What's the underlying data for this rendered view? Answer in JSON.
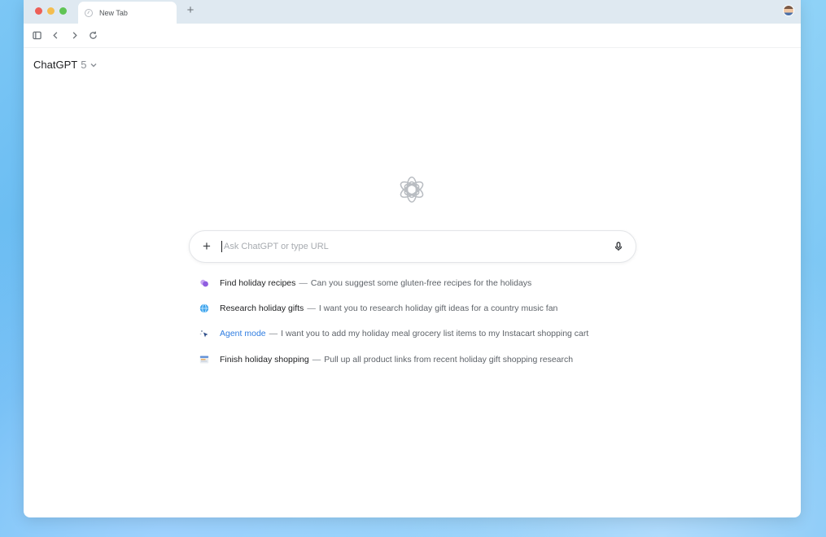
{
  "browser": {
    "tab_label": "New Tab",
    "new_tab_symbol": "+"
  },
  "header": {
    "model_name": "ChatGPT",
    "model_version": "5"
  },
  "search": {
    "placeholder": "Ask ChatGPT or type URL",
    "value": ""
  },
  "suggestions": [
    {
      "title": "Find holiday recipes",
      "separator": "—",
      "description": "Can you suggest some gluten-free recipes for the holidays",
      "icon": "recipe-bubbles-icon"
    },
    {
      "title": "Research holiday gifts",
      "separator": "—",
      "description": "I want you to research holiday gift ideas for a country music fan",
      "icon": "globe-icon"
    },
    {
      "title": "Agent mode",
      "separator": "—",
      "description": "I want you to add my holiday meal grocery list items to my Instacart shopping cart",
      "icon": "agent-cursor-icon"
    },
    {
      "title": "Finish holiday shopping",
      "separator": "—",
      "description": "Pull up all product links from recent holiday gift shopping research",
      "icon": "browser-window-icon"
    }
  ],
  "colors": {
    "agent_accent": "#2f7de1",
    "close_dot": "#ed5f57",
    "minimize_dot": "#f4bd4f",
    "zoom_dot": "#5fc454"
  }
}
